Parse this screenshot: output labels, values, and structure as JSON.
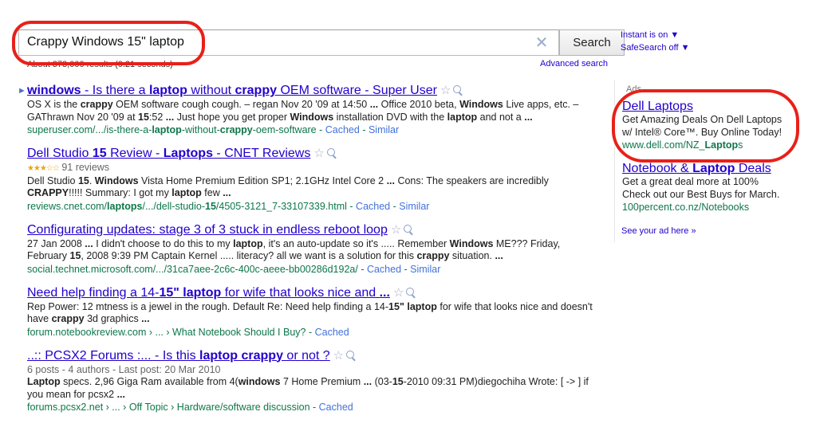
{
  "search": {
    "query": "Crappy Windows 15\" laptop",
    "button_label": "Search",
    "clear": "✕"
  },
  "stats_text": "About 373,000 results (0.21 seconds)",
  "advanced_search": "Advanced search",
  "options": {
    "instant": "Instant is on ▼",
    "safesearch": "SafeSearch off ▼"
  },
  "results": [
    {
      "title_parts": [
        [
          "windows",
          true
        ],
        [
          " - Is there a ",
          false
        ],
        [
          "laptop",
          true
        ],
        [
          " without ",
          false
        ],
        [
          "crappy",
          true
        ],
        [
          " OEM software - Super User",
          false
        ]
      ],
      "meta": "",
      "snippet_parts": [
        [
          "OS X is the ",
          false
        ],
        [
          "crappy",
          true
        ],
        [
          " OEM software cough cough. – regan Nov 20 '09 at 14:50 ",
          false
        ],
        [
          "...",
          true
        ],
        [
          " Office 2010 beta, ",
          false
        ],
        [
          "Windows",
          true
        ],
        [
          " Live apps, etc. – GAThrawn Nov 20 '09 at ",
          false
        ],
        [
          "15",
          true
        ],
        [
          ":52 ",
          false
        ],
        [
          "...",
          true
        ],
        [
          " Just hope you get proper ",
          false
        ],
        [
          "Windows",
          true
        ],
        [
          " installation DVD with the ",
          false
        ],
        [
          "laptop",
          true
        ],
        [
          " and not a ",
          false
        ],
        [
          "...",
          true
        ]
      ],
      "url_parts": [
        [
          "superuser.com/.../is-there-a-",
          false
        ],
        [
          "laptop",
          true
        ],
        [
          "-without-",
          false
        ],
        [
          "crappy",
          true
        ],
        [
          "-oem-software",
          false
        ]
      ],
      "links": [
        "Cached",
        "Similar"
      ]
    },
    {
      "title_parts": [
        [
          "Dell Studio ",
          false
        ],
        [
          "15",
          true
        ],
        [
          " Review - ",
          false
        ],
        [
          "Laptops",
          true
        ],
        [
          " - CNET Reviews",
          false
        ]
      ],
      "rating_stars": "★★★☆☆",
      "meta": "91 reviews",
      "snippet_parts": [
        [
          "Dell Studio ",
          false
        ],
        [
          "15",
          true
        ],
        [
          ". ",
          false
        ],
        [
          "Windows",
          true
        ],
        [
          " Vista Home Premium Edition SP1; 2.1GHz Intel Core 2 ",
          false
        ],
        [
          "...",
          true
        ],
        [
          " Cons: The speakers are incredibly ",
          false
        ],
        [
          "CRAPPY",
          true
        ],
        [
          "!!!!! Summary: I got my ",
          false
        ],
        [
          "laptop",
          true
        ],
        [
          " few ",
          false
        ],
        [
          "...",
          true
        ]
      ],
      "url_parts": [
        [
          "reviews.cnet.com/",
          false
        ],
        [
          "laptops",
          true
        ],
        [
          "/.../dell-studio-",
          false
        ],
        [
          "15",
          true
        ],
        [
          "/4505-3121_7-33107339.html",
          false
        ]
      ],
      "links": [
        "Cached",
        "Similar"
      ]
    },
    {
      "title_parts": [
        [
          "Configurating updates: stage 3 of 3 stuck in endless reboot loop",
          false
        ]
      ],
      "meta": "",
      "snippet_parts": [
        [
          "27 Jan 2008 ",
          false
        ],
        [
          "...",
          true
        ],
        [
          " I didn't choose to do this to my ",
          false
        ],
        [
          "laptop",
          true
        ],
        [
          ", it's an auto-update so it's ..... Remember ",
          false
        ],
        [
          "Windows",
          true
        ],
        [
          " ME??? Friday, February ",
          false
        ],
        [
          "15",
          true
        ],
        [
          ", 2008 9:39 PM Captain Kernel ..... literacy? all we want is a solution for this ",
          false
        ],
        [
          "crappy",
          true
        ],
        [
          " situation. ",
          false
        ],
        [
          "...",
          true
        ]
      ],
      "url_parts": [
        [
          "social.technet.microsoft.com/.../31ca7aee-2c6c-400c-aeee-bb00286d192a/",
          false
        ]
      ],
      "links": [
        "Cached",
        "Similar"
      ]
    },
    {
      "title_parts": [
        [
          "Need help finding a 14-",
          false
        ],
        [
          "15\" laptop",
          true
        ],
        [
          " for wife that looks nice and ",
          false
        ],
        [
          "...",
          true
        ]
      ],
      "meta": "",
      "snippet_parts": [
        [
          "Rep Power: 12 mtness is a jewel in the rough. Default Re: Need help finding a 14-",
          false
        ],
        [
          "15\"",
          true
        ],
        [
          " ",
          false
        ],
        [
          "laptop",
          true
        ],
        [
          " for wife that looks nice and doesn't have ",
          false
        ],
        [
          "crappy",
          true
        ],
        [
          " 3d graphics ",
          false
        ],
        [
          "...",
          true
        ]
      ],
      "url_parts": [
        [
          "forum.notebookreview.com › ... › What Notebook Should I Buy?",
          false
        ]
      ],
      "links": [
        "Cached"
      ]
    },
    {
      "title_parts": [
        [
          "..:: PCSX2 Forums :... - Is this ",
          false
        ],
        [
          "laptop",
          true
        ],
        [
          " ",
          false
        ],
        [
          "crappy",
          true
        ],
        [
          " or not ?",
          false
        ]
      ],
      "meta": "6 posts - 4 authors - Last post: 20 Mar 2010",
      "snippet_parts": [
        [
          "Laptop",
          true
        ],
        [
          " specs. 2,96 Giga Ram available from 4(",
          false
        ],
        [
          "windows",
          true
        ],
        [
          " 7 Home Premium ",
          false
        ],
        [
          "...",
          true
        ],
        [
          " (03-",
          false
        ],
        [
          "15",
          true
        ],
        [
          "-2010 09:31 PM)diegochiha Wrote: [ -> ] if you mean for pcsx2 ",
          false
        ],
        [
          "...",
          true
        ]
      ],
      "url_parts": [
        [
          "forums.pcsx2.net › ... › Off Topic › Hardware/software discussion",
          false
        ]
      ],
      "links": [
        "Cached"
      ]
    }
  ],
  "ads": {
    "label": "Ads",
    "items": [
      {
        "title_parts": [
          [
            "Dell Laptops",
            false
          ]
        ],
        "lines": [
          "Get Amazing Deals On Dell Laptops",
          "w/ Intel® Core™. Buy Online Today!"
        ],
        "url_parts": [
          [
            "www.dell.com/NZ_",
            false
          ],
          [
            "Laptop",
            true
          ],
          [
            "s",
            false
          ]
        ]
      },
      {
        "title_parts": [
          [
            "Notebook & ",
            false
          ],
          [
            "Laptop",
            true
          ],
          [
            " Deals",
            false
          ]
        ],
        "lines": [
          "Get a great deal more at 100%",
          "Check out our Best Buys for March."
        ],
        "url_parts": [
          [
            "100percent.co.nz/Notebooks",
            false
          ]
        ]
      }
    ],
    "see_your_ad": "See your ad here »"
  },
  "annotation_color": "#e8201a"
}
